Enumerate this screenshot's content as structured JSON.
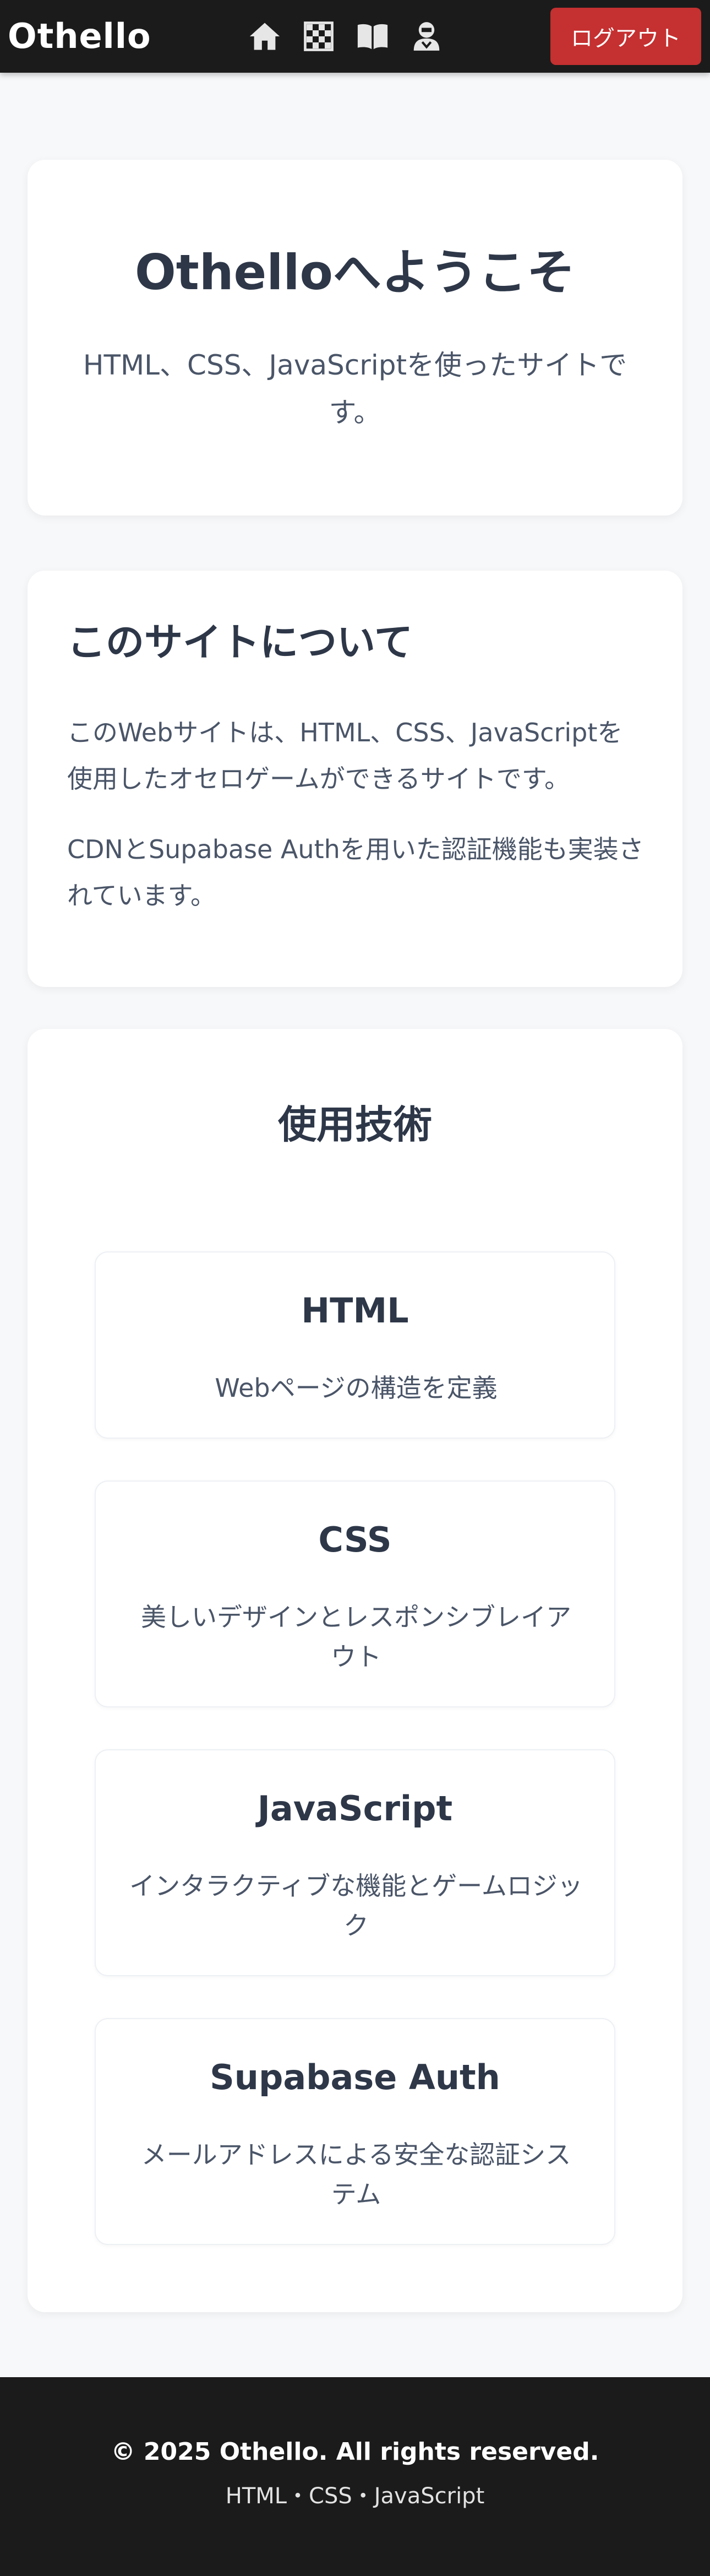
{
  "header": {
    "brand": "Othello",
    "nav": [
      {
        "icon": "home-icon"
      },
      {
        "icon": "checkerboard-icon"
      },
      {
        "icon": "book-icon"
      },
      {
        "icon": "user-icon"
      }
    ],
    "logout_label": "ログアウト",
    "logout_color": "#c53030"
  },
  "hero": {
    "title": "Othelloへようこそ",
    "subtitle": "HTML、CSS、JavaScriptを使ったサイトです。"
  },
  "about": {
    "heading": "このサイトについて",
    "paragraph1": "このWebサイトは、HTML、CSS、JavaScriptを使用したオセロゲームができるサイトです。",
    "paragraph2": "CDNとSupabase Authを用いた認証機能も実装されています。"
  },
  "tech": {
    "heading": "使用技術",
    "items": [
      {
        "title": "HTML",
        "description": "Webページの構造を定義"
      },
      {
        "title": "CSS",
        "description": "美しいデザインとレスポンシブレイアウト"
      },
      {
        "title": "JavaScript",
        "description": "インタラクティブな機能とゲームロジック"
      },
      {
        "title": "Supabase Auth",
        "description": "メールアドレスによる安全な認証システム"
      }
    ]
  },
  "footer": {
    "copyright": "© 2025 Othello. All rights reserved.",
    "tech_line": "HTML・CSS・JavaScript"
  }
}
